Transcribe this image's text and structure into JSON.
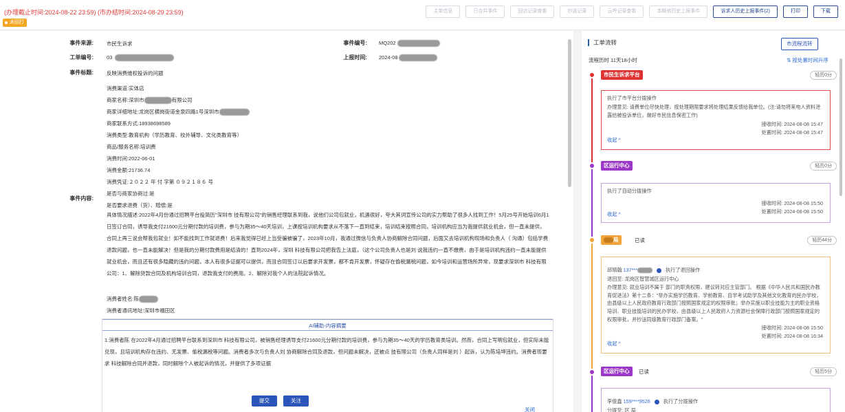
{
  "header": {
    "deadline_text": "(办理截止时间:2024-08-22 23:59) (市办结时间:2024-08-29 23:59)",
    "status_tag": "未回打",
    "buttons": [
      "主单信息",
      "已合并事件",
      "回访记录查看",
      "抄送记录",
      "云呼记录查看",
      "本概格历史上报事件",
      "诉求人历史上报事件(2)",
      "打印",
      "下载"
    ]
  },
  "detail": {
    "source_label": "事件来源:",
    "source_value": "市民生诉求",
    "event_no_label": "事件编号:",
    "event_no_value": "MQ202",
    "work_no_label": "工单编号:",
    "work_no_value": "03",
    "report_time_label": "上报时间:",
    "report_time_value": "2024-08",
    "title_label": "事件标题:",
    "title_value": "反映消费维权投诉的问题",
    "content_label": "事件内容:",
    "lines": [
      "消费渠道:实体店",
      "商家名称:深圳市",
      "商家详细地址:龙岗区横岗街道金泉四路1号深圳市",
      "商家联系方式:18938698589",
      "消费类型:教育机构（学历教育、校外辅导、文化类教育等）",
      "商品/服务名称:培训费",
      "消费时间:2022-06-01",
      "消费金额:21736.74",
      "消费凭证:２０２２ 年 付 字第 ０９２１８６ 号",
      "是否与商家协商过:是",
      "是否要求退费（货）、赔偿:是"
    ],
    "merchant_suffix": "有限公司",
    "situation": "具体情况描述:2022年4月份通过招聘平台投简历\"深圳市            技有限公司\"的销售经理联系到我，说他们公司包就业，机遇很好，夸大其词宣传公司的实力帮助了很多人找到工作！5月25号开始培训6月1日签订合同，诱导我支付21600元分期付款的培训费，参与为期35～40天培训，上课按培训机构要求从不落下一直到结束，培训结束按照合同，培训机构应当为我提供就业机会，但一直未提供，合同上再三说会帮我包就业！如不能找到工作就退费！后来我觉得已经上当受骗被骗了，2023年10月，我通过微信与负责人协商解除合同问题，后面又去培训机构现场和负责人（        沟通）包括学费退款问题，也一直未能解决！但是我的分期付款费用是结清的！直到2024年，深圳          科技有限公司把我告上法庭，（这个公司负责人也是刘      说我违约一直不缴费，由于是培训机构违约一直未能提供就业机会，而且还有很多隐藏的违约问题，本人有很多证据可以提供，而且合同签订以后要求开发票，都不肯开发票，怀疑存在偷税漏税问题，如今培训和运营场所异常，现要求深圳市          科技有限公司：1、解除贷款合同及机构培训合同，退款我支付的费用。2、解除对我个人的法院起诉情况。",
    "consumer_name": "消费者姓名:陈",
    "consumer_addr": "消费者通讯地址:深圳市福田区"
  },
  "ai": {
    "header": "AI辅助-内容摘要",
    "text": "1.消费者陈    在2022年4月通过招聘平台联系到深圳市            科技有限公司，被销售经理诱导支付21600元分期付款的培训费，参与为期35～40天的学历教育类培训。然而，合同上写明包就业，但实际未能兑现，且培训机构存在违约、无发票、偷税漏税等问题。消费者多次与负责人刘    协商解除合同及退款，但问题未解决，还被点            技有限公司（负责人同样是刘    ）起诉，认为陈培坤违约。消费者现要求            科技解除合同并退款，同时解除个人被起诉的情况，并提供了多项证据",
    "close": "关闭"
  },
  "actions": {
    "submit": "提交",
    "follow": "关注"
  },
  "flow": {
    "title": "工单流转",
    "city_flow_button": "市流程流转",
    "duration": "流程历时  11天18小时",
    "sort": "⇅  按处置时间升序",
    "nodes": [
      {
        "tag": "市民生诉求平台",
        "read": "",
        "pill": "轻历0分",
        "card_color": "#d94a4a",
        "rows": [
          "执行了市平台分拨操作",
          "办理意见:    请费单位尽快处理，按处理期限要求将处理结果反馈给我单位。(注:请勿将来电人资料泄露给被投诉单位，做好市民信息保密工作)"
        ],
        "times": [
          "接收时间:    2024-08-08 15:47",
          "处置时间:    2024-08-08 15:47"
        ],
        "collapse": "收起 ^"
      },
      {
        "tag": "区运行中心",
        "read": "",
        "pill": "轻历0分",
        "card_color": "#9b38c8",
        "rows": [
          "执行了自动分拨操作"
        ],
        "times": [
          "接收时间:    2024-08-08 15:50",
          "处置时间:    2024-08-08 15:50"
        ],
        "collapse": "收起 ^"
      },
      {
        "tag": "局",
        "read": "已读",
        "pill": "轻历44分",
        "card_color": "#f2a33a",
        "person": "邱晴翰",
        "phone": "137***",
        "op": "执行了退回操作",
        "rows": [
          "退回至:    龙岗区智慧城区运行中心",
          "办理意见:    就业培训不属于        部门的职责权限，建议转对应主管部门。 根据《中华人民共和国民办教育促进法》第十二条：\"举办实施学历教育、学前教育、自学考试助学及其他文化教育的民办学校，由县级以上人民政府教育行政部门按照国家规定的权限审批；举办实施以职业技能为主的职业资格培训、职业技能培训的民办学校，由县级以上人民政府人力资源社会保障行政部门按照国家规定的权限审批，并抄送同级教育行政部门备案。\""
        ],
        "times": [
          "接收时间:    2024-08-08 15:50",
          "处置时间:    2024-08-08 16:34"
        ],
        "collapse": "收起 ^"
      },
      {
        "tag": "区运行中心",
        "read": "已读",
        "pill": "轻历5分",
        "card_color": "#9b38c8",
        "person": "李俊鑫",
        "phone": "159****9526",
        "op": "执行了分拨操作",
        "rows": [
          "分拨至:    区            局"
        ]
      }
    ]
  }
}
